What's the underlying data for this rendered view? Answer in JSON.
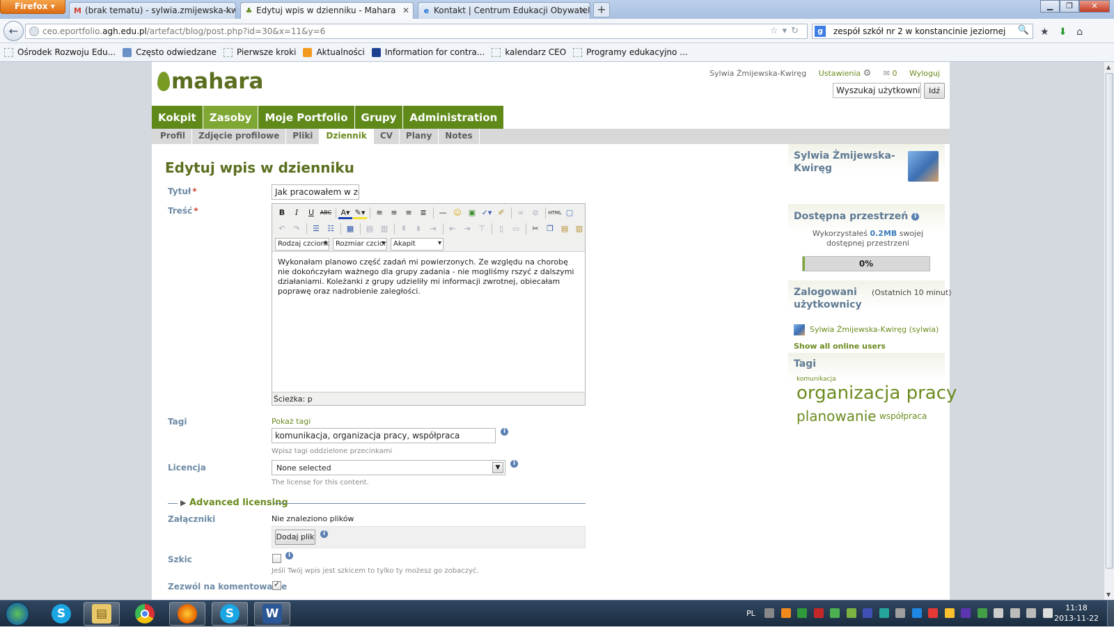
{
  "browser": {
    "menu_button": "Firefox",
    "tabs": [
      {
        "label": "(brak tematu) - sylwia.zmijewska-kwi...",
        "icon": "gmail-icon",
        "active": false
      },
      {
        "label": "Edytuj wpis w dzienniku - Mahara",
        "icon": "mahara-icon",
        "active": true
      },
      {
        "label": "Kontakt | Centrum Edukacji Obywatel...",
        "icon": "ie-icon",
        "active": false
      }
    ],
    "url_prefix": "ceo.eportfolio.",
    "url_domain": "agh.edu.pl",
    "url_path": "/artefact/blog/post.php?id=30&x=11&y=6",
    "search_value": "zespół szkół nr 2 w konstancinie jeziornej",
    "bookmarks": [
      "Ośrodek Rozwoju Edu...",
      "Często odwiedzane",
      "Pierwsze kroki",
      "Aktualności",
      "Information for contra...",
      "kalendarz CEO",
      "Programy edukacyjno ..."
    ]
  },
  "header": {
    "logo_text": "mahara",
    "username": "Sylwia Żmijewska-Kwiręg",
    "settings_label": "Ustawienia",
    "inbox_count": "0",
    "logout_label": "Wyloguj",
    "user_search_value": "Wyszukaj użytkowników",
    "user_search_button": "Idź"
  },
  "main_nav": [
    {
      "label": "Kokpit",
      "active": false
    },
    {
      "label": "Zasoby",
      "active": true
    },
    {
      "label": "Moje Portfolio",
      "active": false
    },
    {
      "label": "Grupy",
      "active": false
    },
    {
      "label": "Administration",
      "active": false
    }
  ],
  "sub_nav": [
    {
      "label": "Profil",
      "active": false
    },
    {
      "label": "Zdjęcie profilowe",
      "active": false
    },
    {
      "label": "Pliki",
      "active": false
    },
    {
      "label": "Dziennik",
      "active": true
    },
    {
      "label": "CV",
      "active": false
    },
    {
      "label": "Plany",
      "active": false
    },
    {
      "label": "Notes",
      "active": false
    }
  ],
  "form": {
    "title": "Edytuj wpis w dzienniku",
    "title_label": "Tytuł",
    "title_value": "Jak pracowałem w zespole",
    "body_label": "Treść",
    "font_family_select": "Rodzaj czcionki",
    "font_size_select": "Rozmiar czcionki",
    "format_select": "Akapit",
    "body_text": "Wykonałam planowo część zadań mi powierzonych. Ze względu na chorobę nie dokończyłam ważnego dla grupy zadania - nie mogliśmy rszyć z dalszymi działaniami. Koleżanki z grupy udzieliły mi informacji zwrotnej, obiecałam poprawę oraz nadrobienie zaległości.",
    "path_label": "Ścieżka: p",
    "tags_label": "Tagi",
    "show_tags": "Pokaż tagi",
    "tags_value": "komunikacja, organizacja pracy, współpraca",
    "tags_help": "Wpisz tagi oddzielone przecinkami",
    "license_label": "Licencja",
    "license_value": "None selected",
    "license_help": "The license for this content.",
    "advanced_licensing": "Advanced licensing",
    "attachments_label": "Załączniki",
    "no_files": "Nie znaleziono plików",
    "add_file_button": "Dodaj plik",
    "draft_label": "Szkic",
    "draft_help": "Jeśli Twój wpis jest szkicem to tylko ty możesz go zobaczyć.",
    "allow_comments_label": "Zezwól na komentowanie"
  },
  "sidebar": {
    "profile_name": "Sylwia Żmijewska-Kwiręg",
    "quota_title": "Dostępna przestrzeń",
    "quota_text_1": "Wykorzystałeś",
    "quota_used": "0.2MB",
    "quota_text_2": "swojej dostępnej przestrzeni",
    "quota_percent_label": "0%",
    "quota_fraction": 0.005,
    "online_title": "Zalogowani użytkownicy",
    "online_period": "(Ostatnich 10 minut)",
    "online_user": "Sylwia Żmijewska-Kwiręg (sylwia)",
    "show_all_online": "Show all online users",
    "tags_title": "Tagi",
    "tag_cloud": [
      "komunikacja",
      "organizacja pracy",
      "planowanie",
      "współpraca"
    ]
  },
  "taskbar": {
    "language": "PL",
    "time": "11:18",
    "date": "2013-11-22",
    "apps": [
      "skype-icon",
      "explorer-icon",
      "chrome-icon",
      "firefox-icon",
      "skype-icon",
      "word-icon"
    ]
  },
  "colors": {
    "mahara_green": "#5f8a1a",
    "mahara_green_active": "#7ea733",
    "label_blue": "#6d8ba6",
    "link_green": "#6a8b1e"
  }
}
